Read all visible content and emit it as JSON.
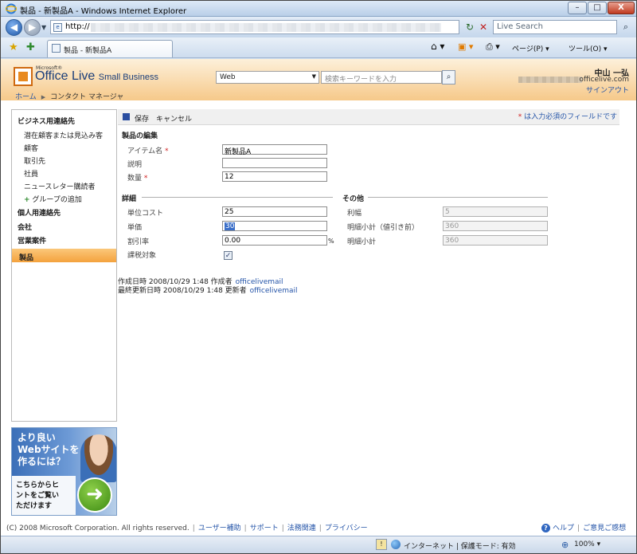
{
  "window": {
    "title": "製品 - 新製品A - Windows Internet Explorer",
    "min_glyph": "–",
    "max_glyph": "□",
    "close_glyph": "X"
  },
  "address_bar": {
    "url": "http://",
    "live_search_placeholder": "Live Search"
  },
  "tabs": [
    {
      "label": "製品 - 新製品A"
    }
  ],
  "commands": {
    "page": "ページ(P) ▾",
    "tools": "ツール(O) ▾"
  },
  "site_header": {
    "ms_label": "Microsoft®",
    "product_name": "Office Live",
    "product_suffix": "Small Business",
    "scope_select": "Web",
    "search_placeholder": "検索キーワードを入力",
    "user_name": "中山 一弘",
    "user_domain": "officelive.com",
    "signout": "サインアウト"
  },
  "breadcrumb": {
    "home": "ホーム",
    "current": "コンタクト マネージャ"
  },
  "sidebar": {
    "business_heading": "ビジネス用連絡先",
    "business_items": [
      "潜在顧客または見込み客",
      "顧客",
      "取引先",
      "社員",
      "ニュースレター購読者"
    ],
    "add_group": "グループの追加",
    "personal": "個人用連絡先",
    "company": "会社",
    "deals": "営業案件",
    "products": "製品"
  },
  "ad": {
    "line1": "より良い",
    "line2": "Webサイトを",
    "line3": "作るには？",
    "sub1": "こちらからヒ",
    "sub2": "ントをご覧い",
    "sub3": "ただけます"
  },
  "toolbar": {
    "save": "保存",
    "cancel": "キャンセル",
    "required_note": "は入力必須のフィールドです"
  },
  "form": {
    "edit_title": "製品の編集",
    "item_name_label": "アイテム名",
    "item_name_value": "新製品A",
    "description_label": "説明",
    "description_value": "",
    "quantity_label": "数量",
    "quantity_value": "12",
    "details_title": "詳細",
    "unit_cost_label": "単位コスト",
    "unit_cost_value": "25",
    "unit_price_label": "単価",
    "unit_price_value": "30",
    "discount_label": "割引率",
    "discount_value": "0.00",
    "discount_unit": "%",
    "taxable_label": "課税対象",
    "taxable_checked": true,
    "other_title": "その他",
    "margin_label": "利幅",
    "margin_value": "5",
    "subtotal_pre_label": "明細小計（値引き前）",
    "subtotal_pre_value": "360",
    "subtotal_label": "明細小計",
    "subtotal_value": "360"
  },
  "meta": {
    "created": "作成日時 2008/10/29 1:48  作成者",
    "created_by": "officelivemail",
    "updated": "最終更新日時 2008/10/29 1:48  更新者",
    "updated_by": "officelivemail"
  },
  "footer": {
    "copyright": "(C) 2008 Microsoft Corporation. All rights reserved.",
    "links": [
      "ユーザー補助",
      "サポート",
      "法務関連",
      "プライバシー"
    ],
    "help": "ヘルプ",
    "feedback": "ご意見ご感想"
  },
  "statusbar": {
    "zone": "インターネット | 保護モード: 有効",
    "zoom": "100%"
  }
}
